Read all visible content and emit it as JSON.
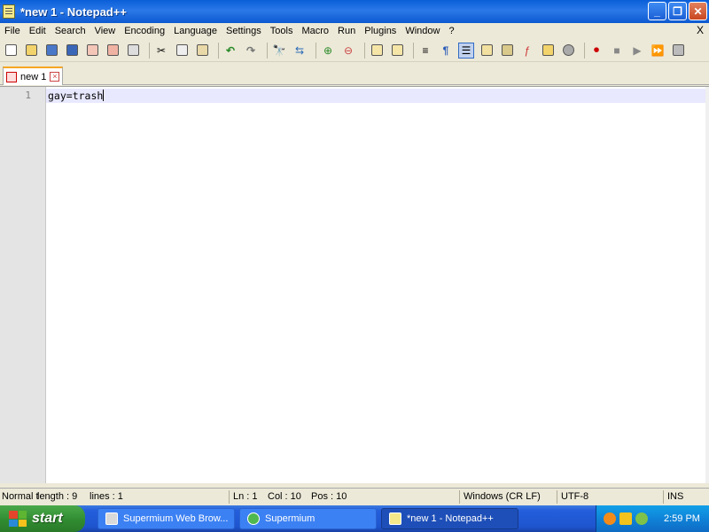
{
  "window": {
    "title": "*new 1 - Notepad++"
  },
  "menu": [
    "File",
    "Edit",
    "Search",
    "View",
    "Encoding",
    "Language",
    "Settings",
    "Tools",
    "Macro",
    "Run",
    "Plugins",
    "Window",
    "?"
  ],
  "menu_close": "X",
  "tab": {
    "label": "new 1"
  },
  "editor": {
    "line_number": "1",
    "text": "gay=trash"
  },
  "status": {
    "doc_type": "Normal t",
    "length": "length : 9",
    "lines": "lines : 1",
    "ln": "Ln : 1",
    "col": "Col : 10",
    "pos": "Pos : 10",
    "eol": "Windows (CR LF)",
    "encoding": "UTF-8",
    "ins": "INS"
  },
  "taskbar": {
    "start_label": "start",
    "tasks": [
      "Supermium Web Brow...",
      "Supermium",
      "*new 1 - Notepad++"
    ],
    "clock": "2:59 PM"
  },
  "colors": {
    "titlebar": "#0a5fd8",
    "taskbar": "#245edb",
    "start": "#2f8a2f",
    "current_line": "#e8e8ff"
  }
}
